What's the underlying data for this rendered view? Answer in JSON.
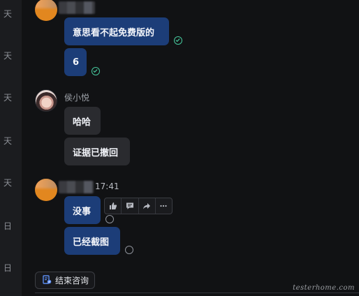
{
  "rail": {
    "labels": [
      "天",
      "天",
      "天",
      "天",
      "天",
      "日",
      "日"
    ]
  },
  "messages": {
    "m1": "意思看不起免费版的",
    "m2": "6",
    "m3_sender": "侯小悦",
    "m3": "哈哈",
    "m4": "证据已撤回",
    "m5_time": "17:41",
    "m5": "没事",
    "m6": "已经截图"
  },
  "message_toolbar": {
    "icons": [
      "thumbs-up-icon",
      "comment-icon",
      "forward-icon",
      "more-icon"
    ]
  },
  "footer": {
    "end_consult_label": "结束咨询",
    "end_consult_icon": "end-consult-icon"
  },
  "watermark": "testerhome.com",
  "colors": {
    "my_bubble": "#1c3d78",
    "other_bubble": "#2a2b2f",
    "read_check": "#46c89d",
    "background": "#111214"
  }
}
